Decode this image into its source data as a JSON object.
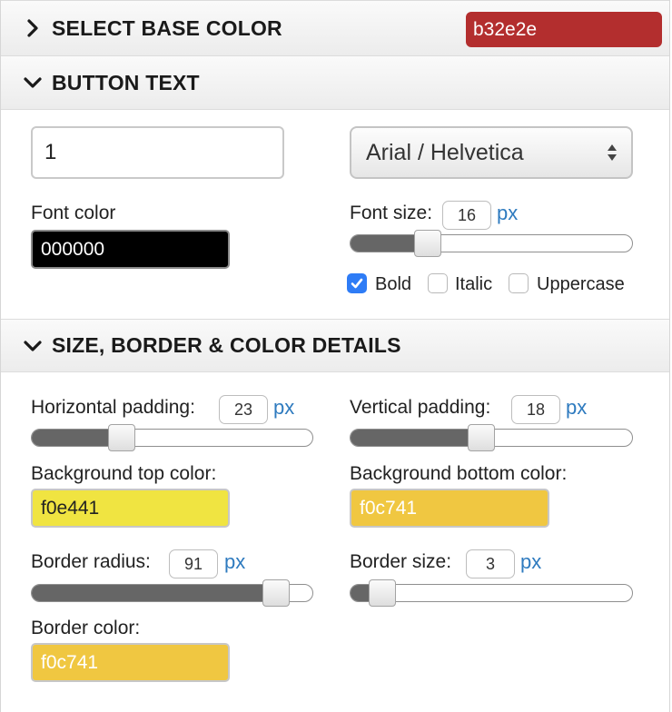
{
  "base_color": {
    "title": "SELECT BASE COLOR",
    "value": "b32e2e",
    "swatch_color": "#b32e2e",
    "expanded": false
  },
  "button_text": {
    "title": "BUTTON TEXT",
    "expanded": true,
    "text_value": "1",
    "font_family": "Arial / Helvetica",
    "font_color_label": "Font color",
    "font_color_value": "000000",
    "font_color_swatch": "#000000",
    "font_size_label": "Font size:",
    "font_size_value": "16",
    "font_size_unit": "px",
    "font_size_fraction": 0.25,
    "bold_label": "Bold",
    "bold_checked": true,
    "italic_label": "Italic",
    "italic_checked": false,
    "uppercase_label": "Uppercase",
    "uppercase_checked": false
  },
  "details": {
    "title": "SIZE, BORDER & COLOR DETAILS",
    "expanded": true,
    "h_padding_label": "Horizontal padding:",
    "h_padding_value": "23",
    "h_padding_unit": "px",
    "h_padding_fraction": 0.3,
    "v_padding_label": "Vertical padding:",
    "v_padding_value": "18",
    "v_padding_unit": "px",
    "v_padding_fraction": 0.46,
    "bg_top_label": "Background top color:",
    "bg_top_value": "f0e441",
    "bg_top_swatch": "#f0e441",
    "bg_bottom_label": "Background bottom color:",
    "bg_bottom_value": "f0c741",
    "bg_bottom_swatch": "#f0c741",
    "radius_label": "Border radius:",
    "radius_value": "91",
    "radius_unit": "px",
    "radius_fraction": 0.91,
    "border_size_label": "Border size:",
    "border_size_value": "3",
    "border_size_unit": "px",
    "border_size_fraction": 0.07,
    "border_color_label": "Border color:",
    "border_color_value": "f0c741",
    "border_color_swatch": "#f0c741"
  }
}
